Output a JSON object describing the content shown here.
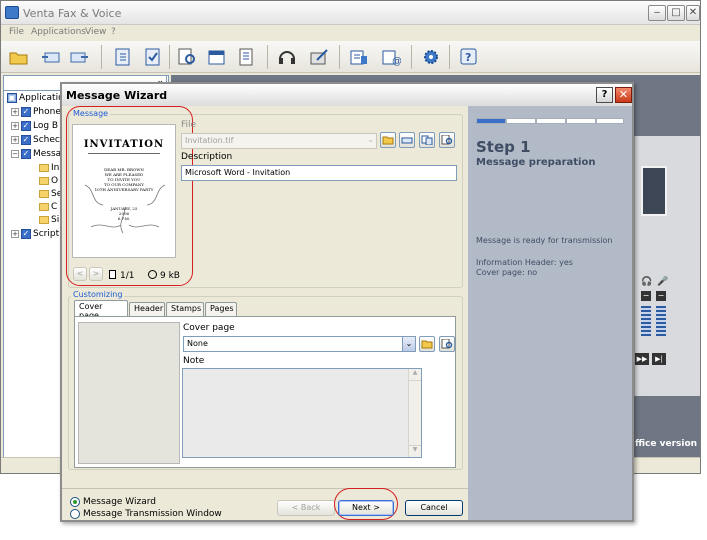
{
  "app": {
    "title": "Venta Fax & Voice",
    "menu": [
      "File",
      "Applications",
      "View",
      "?"
    ],
    "tree": [
      "Application",
      "Phone",
      "Log B",
      "Schec",
      "Messa",
      "In",
      "O",
      "Se",
      "C",
      "Si",
      "Script"
    ],
    "office_text": "ffice version"
  },
  "dialog": {
    "title": "Message Wizard",
    "help_label": "?",
    "close_label": "✕",
    "message_group": "Message",
    "file_label": "File",
    "file_value": "Invitation.tif",
    "description_label": "Description",
    "description_value": "Microsoft Word - Invitation",
    "page_counter": "1/1",
    "file_size": "9 kB",
    "thumbnail": {
      "title": "INVITATION",
      "lines": [
        "DEAR MR. BROWN",
        "WE ARE PLEASED",
        "TO INVITE YOU",
        "TO OUR COMPANY",
        "10TH ANNIVERSARY PARTY"
      ],
      "date": "JANUARY, 25",
      "year": "2006",
      "time": "6 P.M."
    },
    "customizing_group": "Customizing",
    "tabs": [
      "Cover page",
      "Header",
      "Stamps",
      "Pages"
    ],
    "cover_page_label": "Cover page",
    "cover_page_value": "None",
    "note_label": "Note",
    "mode_options": [
      "Message Wizard",
      "Message Transmission Window"
    ],
    "mode_selected": 0,
    "back_label": "< Back",
    "next_label": "Next >",
    "cancel_label": "Cancel",
    "step": {
      "title": "Step 1",
      "subtitle": "Message preparation",
      "status": "Message is ready for transmission",
      "info_header": "Information Header: yes",
      "cover_page": "Cover page: no",
      "progress_segments": 5,
      "progress_current": 1
    }
  },
  "colors": {
    "accent_blue": "#1d5bd3",
    "step_panel": "#b3bac7",
    "highlight_red": "#d42020",
    "progress_active": "#3a6ec7"
  }
}
